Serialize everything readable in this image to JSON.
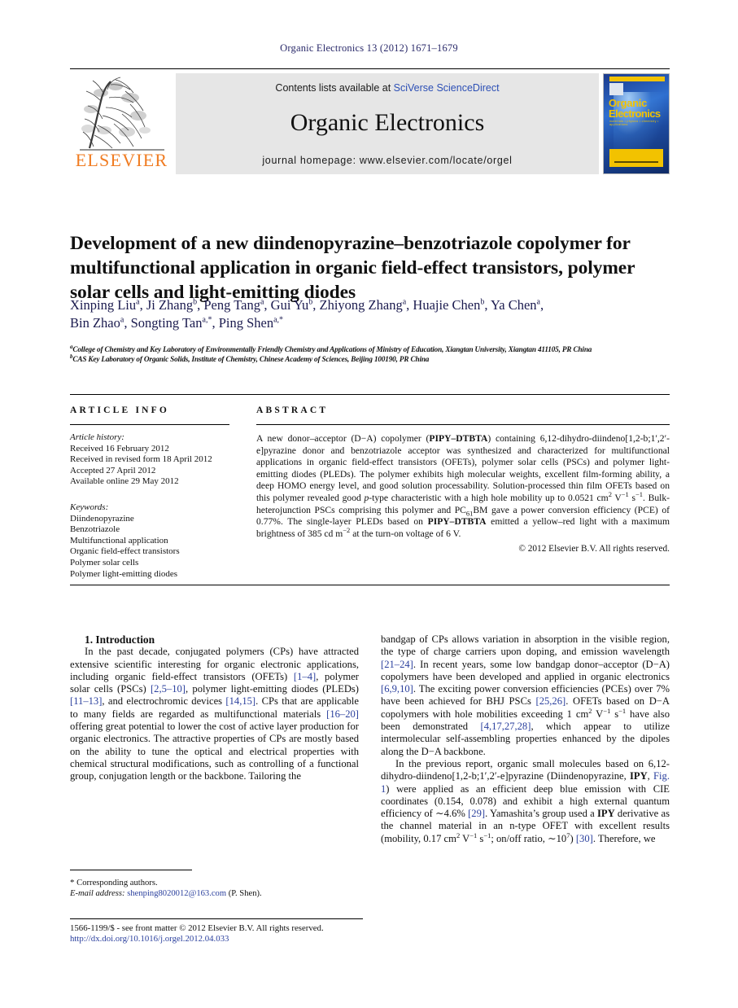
{
  "running_head": "Organic Electronics 13 (2012) 1671–1679",
  "banner": {
    "contents_prefix": "Contents lists available at ",
    "contents_link": "SciVerse ScienceDirect",
    "journal_title": "Organic Electronics",
    "homepage": "journal homepage: www.elsevier.com/locate/orgel",
    "publisher_name": "ELSEVIER",
    "cover": {
      "line1": "Organic",
      "line2": "Electronics",
      "subtitle": "materials • physics • chemistry • applications"
    }
  },
  "title": "Development of a new diindenopyrazine–benzotriazole copolymer for multifunctional application in organic field-effect transistors, polymer solar cells and light-emitting diodes",
  "authors_line1": "Xinping Liu ᵃ, Ji Zhang ᵇ, Peng Tang ᵃ, Gui Yu ᵇ, Zhiyong Zhang ᵃ, Huajie Chen ᵇ, Ya Chen ᵃ,",
  "authors_line2": "Bin Zhao ᵃ, Songting Tan ᵃ,*, Ping Shen ᵃ,*",
  "authors": [
    {
      "name": "Xinping Liu",
      "mark": "a"
    },
    {
      "name": "Ji Zhang",
      "mark": "b"
    },
    {
      "name": "Peng Tang",
      "mark": "a"
    },
    {
      "name": "Gui Yu",
      "mark": "b"
    },
    {
      "name": "Zhiyong Zhang",
      "mark": "a"
    },
    {
      "name": "Huajie Chen",
      "mark": "b"
    },
    {
      "name": "Ya Chen",
      "mark": "a"
    },
    {
      "name": "Bin Zhao",
      "mark": "a"
    },
    {
      "name": "Songting Tan",
      "mark": "a,*"
    },
    {
      "name": "Ping Shen",
      "mark": "a,*"
    }
  ],
  "affiliations": [
    {
      "mark": "a",
      "text": "College of Chemistry and Key Laboratory of Environmentally Friendly Chemistry and Applications of Ministry of Education, Xiangtan University, Xiangtan 411105, PR China"
    },
    {
      "mark": "b",
      "text": "CAS Key Laboratory of Organic Solids, Institute of Chemistry, Chinese Academy of Sciences, Beijing 100190, PR China"
    }
  ],
  "article_info": {
    "heading": "ARTICLE INFO",
    "history_label": "Article history:",
    "history": [
      "Received 16 February 2012",
      "Received in revised form 18 April 2012",
      "Accepted 27 April 2012",
      "Available online 29 May 2012"
    ],
    "keywords_label": "Keywords:",
    "keywords": [
      "Diindenopyrazine",
      "Benzotriazole",
      "Multifunctional application",
      "Organic field-effect transistors",
      "Polymer solar cells",
      "Polymer light-emitting diodes"
    ]
  },
  "abstract": {
    "heading": "ABSTRACT",
    "copyright": "© 2012 Elsevier B.V. All rights reserved."
  },
  "introduction": {
    "heading": "1. Introduction"
  },
  "footnote": {
    "star": "*",
    "corresponding": "Corresponding authors.",
    "email_label": "E-mail address:",
    "email": "shenping8020012@163.com",
    "email_owner": "(P. Shen)."
  },
  "issn": {
    "line": "1566-1199/$ - see front matter © 2012 Elsevier B.V. All rights reserved.",
    "doi": "http://dx.doi.org/10.1016/j.orgel.2012.04.033"
  },
  "colors": {
    "link": "#2a3f9d",
    "elsevier_orange": "#F07C22",
    "banner_grey": "#e6e6e6",
    "cover_yellow": "#f2c200",
    "author_ink": "#1a1a4e"
  }
}
